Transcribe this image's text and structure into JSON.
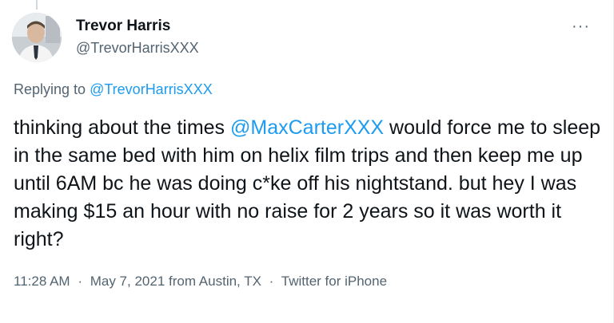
{
  "author": {
    "name": "Trevor Harris",
    "handle": "@TrevorHarrisXXX",
    "avatar_icon": "person-avatar-icon"
  },
  "more_label": "···",
  "reply": {
    "prefix": "Replying to",
    "handle": "@TrevorHarrisXXX"
  },
  "tweet": {
    "text_before": "thinking about the times ",
    "mention": "@MaxCarterXXX",
    "text_after": " would force me to sleep in the same bed with him on helix film trips and then keep me up until 6AM bc he was doing c*ke off his nightstand. but hey I was making $15 an hour with no raise for 2 years so it was worth it right?"
  },
  "meta": {
    "time": "11:28 AM",
    "separator": "·",
    "date": "May 7, 2021",
    "location": "from Austin, TX",
    "source": "Twitter for iPhone"
  },
  "colors": {
    "link": "#1d9bf0",
    "secondary_text": "#536471",
    "primary_text": "#0f1419"
  }
}
